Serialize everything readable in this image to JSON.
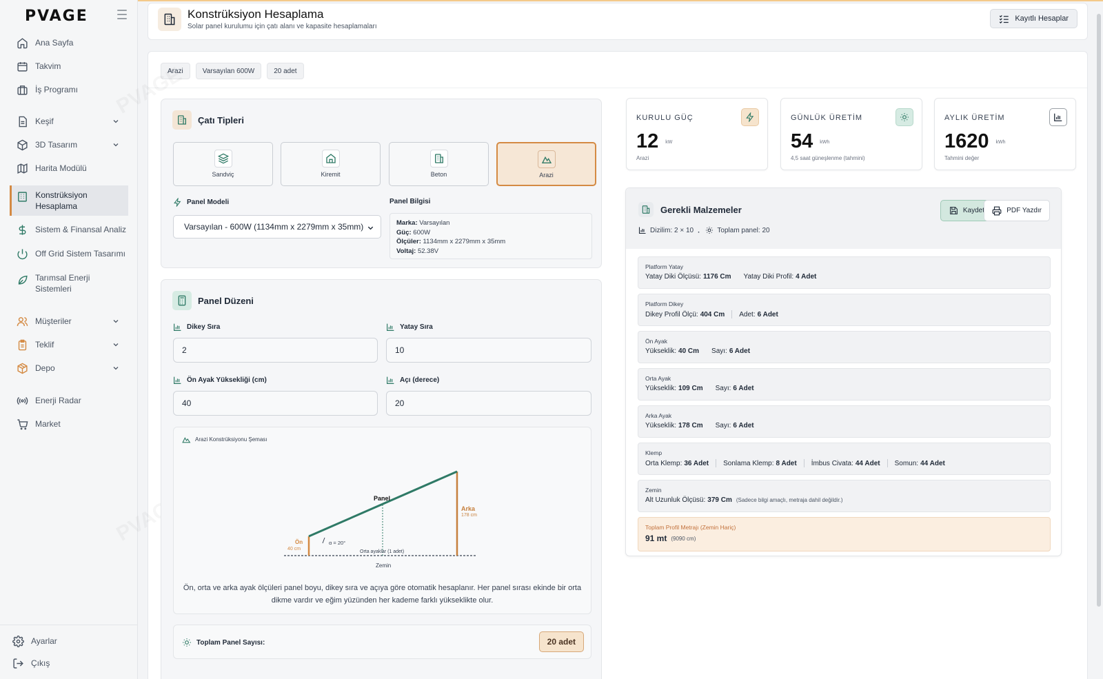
{
  "brand": {
    "logo": "PVAGE",
    "accent": "#d48a43",
    "green": "#2f7a66"
  },
  "sidebar": {
    "items": [
      {
        "label": "Ana Sayfa",
        "icon": "home-icon"
      },
      {
        "label": "Takvim",
        "icon": "calendar-icon"
      },
      {
        "label": "İş Programı",
        "icon": "briefcase-icon"
      },
      {
        "label": "Keşif",
        "icon": "document-icon",
        "expandable": true
      },
      {
        "label": "3D Tasarım",
        "icon": "cube-icon",
        "expandable": true
      },
      {
        "label": "Harita Modülü",
        "icon": "map-icon"
      },
      {
        "label": "Konstrüksiyon Hesaplama",
        "icon": "building-icon",
        "active": true
      },
      {
        "label": "Sistem & Finansal Analiz",
        "icon": "dollar-icon"
      },
      {
        "label": "Off Grid Sistem Tasarımı",
        "icon": "power-icon"
      },
      {
        "label": "Tarımsal Enerji Sistemleri",
        "icon": "leaf-icon"
      },
      {
        "label": "Müşteriler",
        "icon": "users-icon",
        "expandable": true
      },
      {
        "label": "Teklif",
        "icon": "clipboard-icon",
        "expandable": true
      },
      {
        "label": "Depo",
        "icon": "package-icon",
        "expandable": true
      },
      {
        "label": "Enerji Radar",
        "icon": "radar-icon"
      },
      {
        "label": "Market",
        "icon": "cart-icon"
      }
    ],
    "bottom": [
      {
        "label": "Ayarlar",
        "icon": "gear-icon"
      },
      {
        "label": "Çıkış",
        "icon": "logout-icon"
      }
    ]
  },
  "header": {
    "title": "Konstrüksiyon Hesaplama",
    "subtitle": "Solar panel kurulumu için çatı alanı ve kapasite hesaplamaları",
    "saved_button": "Kayıtlı Hesaplar"
  },
  "chips": [
    "Arazi",
    "Varsayılan 600W",
    "20 adet"
  ],
  "roof": {
    "title": "Çatı Tipleri",
    "options": [
      {
        "label": "Sandviç",
        "icon": "layers-icon"
      },
      {
        "label": "Kiremit",
        "icon": "house-icon"
      },
      {
        "label": "Beton",
        "icon": "building-icon"
      },
      {
        "label": "Arazi",
        "icon": "mountain-icon",
        "selected": true
      }
    ],
    "panel_model_label": "Panel Modeli",
    "panel_model_value": "Varsayılan - 600W (1134mm x 2279mm x 35mm)",
    "panel_info_label": "Panel Bilgisi",
    "panel_info": {
      "brand_key": "Marka:",
      "brand_val": "Varsayılan",
      "power_key": "Güç:",
      "power_val": "600W",
      "dims_key": "Ölçüler:",
      "dims_val": "1134mm x 2279mm x 35mm",
      "volt_key": "Voltaj:",
      "volt_val": "52.38V"
    }
  },
  "layout": {
    "title": "Panel Düzeni",
    "vertical_label": "Dikey Sıra",
    "vertical_value": "2",
    "horizontal_label": "Yatay Sıra",
    "horizontal_value": "10",
    "front_leg_label": "Ön Ayak Yüksekliği (cm)",
    "front_leg_value": "40",
    "angle_label": "Açı (derece)",
    "angle_value": "20",
    "diagram": {
      "title": "Arazi Konstrüksiyonu Şeması",
      "panel": "Panel",
      "back": "Arka",
      "back_cm": "178 cm",
      "front": "Ön",
      "front_cm": "40 cm",
      "angle": "α = 20°",
      "middle": "Orta ayaklar (1 adet)",
      "ground": "Zemin",
      "note": "Ön, orta ve arka ayak ölçüleri panel boyu, dikey sıra ve açıya göre otomatik hesaplanır. Her panel sırası ekinde bir orta dikme vardır ve eğim yüzünden her kademe farklı yükseklikte olur."
    },
    "total_label": "Toplam Panel Sayısı:",
    "total_value": "20 adet"
  },
  "stats": [
    {
      "label": "KURULU GÜÇ",
      "value": "12",
      "unit": "kW",
      "sub": "Arazi",
      "icon": "bolt-icon"
    },
    {
      "label": "GÜNLÜK ÜRETİM",
      "value": "54",
      "unit": "kWh",
      "sub": "4,5 saat güneşlenme (tahmini)",
      "icon": "sun-icon"
    },
    {
      "label": "AYLIK ÜRETİM",
      "value": "1620",
      "unit": "kWh",
      "sub": "Tahmini değer",
      "icon": "bar-chart-icon"
    }
  ],
  "materials": {
    "title": "Gerekli Malzemeler",
    "layout_text": "Dizilim: 2 × 10",
    "total_panels_text": "Toplam panel: 20",
    "save_button": "Kaydet",
    "pdf_button": "PDF Yazdır",
    "rows": [
      {
        "title": "Platform Yatay",
        "items": [
          {
            "k": "Yatay Diki Ölçüsü:",
            "v": "1176 Cm"
          },
          {
            "k": "Yatay Diki Profil:",
            "v": "4 Adet"
          }
        ]
      },
      {
        "title": "Platform Dikey",
        "items": [
          {
            "k": "Dikey Profil Ölçü:",
            "v": "404 Cm"
          },
          {
            "k": "Adet:",
            "v": "6 Adet"
          }
        ]
      },
      {
        "title": "Ön Ayak",
        "items": [
          {
            "k": "Yükseklik:",
            "v": "40 Cm"
          },
          {
            "k": "Sayı:",
            "v": "6 Adet"
          }
        ]
      },
      {
        "title": "Orta Ayak",
        "items": [
          {
            "k": "Yükseklik:",
            "v": "109 Cm"
          },
          {
            "k": "Sayı:",
            "v": "6 Adet"
          }
        ]
      },
      {
        "title": "Arka Ayak",
        "items": [
          {
            "k": "Yükseklik:",
            "v": "178 Cm"
          },
          {
            "k": "Sayı:",
            "v": "6 Adet"
          }
        ]
      },
      {
        "title": "Klemp",
        "items": [
          {
            "k": "Orta Klemp:",
            "v": "36 Adet"
          },
          {
            "k": "Sonlama Klemp:",
            "v": "8 Adet"
          },
          {
            "k": "İmbus Civata:",
            "v": "44 Adet"
          },
          {
            "k": "Somun:",
            "v": "44 Adet"
          }
        ]
      },
      {
        "title": "Zemin",
        "items": [
          {
            "k": "Alt Uzunluk Ölçüsü:",
            "v": "379 Cm"
          }
        ],
        "note": "(Sadece bilgi amaçlı, metraja dahil değildir.)"
      }
    ],
    "total_title": "Toplam Profil Metrajı (Zemin Hariç)",
    "total_value": "91 mt",
    "total_note": "(9090 cm)"
  }
}
